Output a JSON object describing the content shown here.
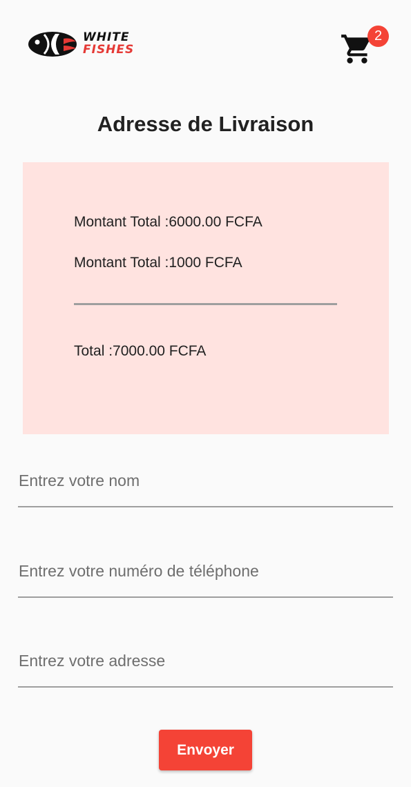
{
  "header": {
    "logo": {
      "line1": "WHITE",
      "line2": "FISHES",
      "icon": "fish-logo-icon"
    },
    "cart": {
      "icon": "shopping-cart-icon",
      "badge_count": "2"
    }
  },
  "page": {
    "title": "Adresse de Livraison"
  },
  "summary": {
    "line1": "Montant Total :6000.00 FCFA",
    "line2": "Montant Total :1000 FCFA",
    "total": "Total :7000.00 FCFA"
  },
  "form": {
    "name": {
      "value": "",
      "placeholder": "Entrez votre nom"
    },
    "phone": {
      "value": "",
      "placeholder": "Entrez votre numéro de téléphone"
    },
    "address": {
      "value": "",
      "placeholder": "Entrez votre adresse"
    },
    "submit_label": "Envoyer"
  },
  "colors": {
    "accent": "#f44336",
    "summary_background": "#ffe3e0",
    "page_background": "#fafafa"
  }
}
